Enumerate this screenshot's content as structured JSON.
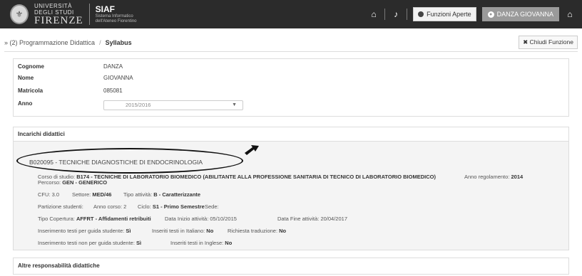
{
  "header": {
    "university_line1": "UNIVERSITÀ",
    "university_line2": "DEGLI STUDI",
    "university_line3": "FIRENZE",
    "brand": "SIAF",
    "brand_sub1": "Sistema Informatico",
    "brand_sub2": "dell'Ateneo Fiorentino",
    "open_functions_label": "Funzioni Aperte",
    "user_label": "DANZA GIOVANNA"
  },
  "breadcrumb": {
    "parent": "» (2) Programmazione Didattica",
    "separator": "/",
    "current": "Syllabus",
    "close_label": "✖ Chiudi Funzione"
  },
  "student": {
    "cognome_label": "Cognome",
    "cognome_value": "DANZA",
    "nome_label": "Nome",
    "nome_value": "GIOVANNA",
    "matricola_label": "Matricola",
    "matricola_value": "085081",
    "anno_label": "Anno",
    "anno_value": "2015/2016"
  },
  "teaching": {
    "section_title": "Incarichi didattici",
    "course_code_title": "B020095 - TECNICHE DIAGNOSTICHE DI ENDOCRINOLOGIA",
    "corso_label": "Corso di studio:",
    "corso_value": "B174 - TECNICHE DI LABORATORIO BIOMEDICO (ABILITANTE ALLA PROFESSIONE SANITARIA DI TECNICO DI LABORATORIO BIOMEDICO)",
    "anno_reg_label": "Anno regolamento:",
    "anno_reg_value": "2014",
    "percorso_label": "Percorso:",
    "percorso_value": "GEN - GENERICO",
    "cfu_label": "CFU:",
    "cfu_value": "3.0",
    "settore_label": "Settore:",
    "settore_value": "MED/46",
    "tipo_att_label": "Tipo attività:",
    "tipo_att_value": "B - Caratterizzante",
    "partizione_label": "Partizione studenti:",
    "anno_corso_label": "Anno corso:",
    "anno_corso_value": "2",
    "ciclo_label": "Ciclo:",
    "ciclo_value": "S1 - Primo Semestre",
    "sede_label": "Sede:",
    "copertura_label": "Tipo Copertura:",
    "copertura_value": "AFFRT - Affidamenti retribuiti",
    "inizio_label": "Data Inizio attività:",
    "inizio_value": "05/10/2015",
    "fine_label": "Data Fine attività:",
    "fine_value": "20/04/2017",
    "ins_guida_label": "Inserimento testi per guida studente:",
    "ins_guida_value": "Sì",
    "ins_it_label": "Inseriti testi in Italiano:",
    "ins_it_value": "No",
    "richiesta_label": "Richiesta traduzione:",
    "richiesta_value": "No",
    "ins_non_guida_label": "Inserimento testi non per guida studente:",
    "ins_non_guida_value": "Sì",
    "ins_en_label": "Inseriti testi in Inglese:",
    "ins_en_value": "No"
  },
  "other_section_title": "Altre responsabilità didattiche"
}
